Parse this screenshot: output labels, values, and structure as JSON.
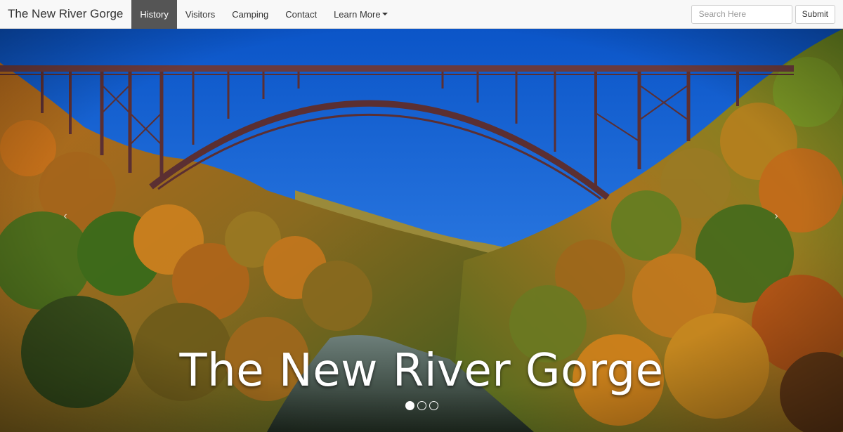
{
  "navbar": {
    "brand": "The New River Gorge",
    "items": [
      {
        "label": "History",
        "active": true
      },
      {
        "label": "Visitors"
      },
      {
        "label": "Camping"
      },
      {
        "label": "Contact"
      },
      {
        "label": "Learn More",
        "dropdown": true
      }
    ],
    "search": {
      "placeholder": "Search Here",
      "value": ""
    },
    "submit_label": "Submit"
  },
  "carousel": {
    "caption": "The New River Gorge",
    "prev_icon": "‹",
    "next_icon": "›",
    "slide_count": 3,
    "active_slide": 1
  },
  "colors": {
    "sky": "#1f74e0",
    "bridge": "#5b2f32",
    "foliage_orange": "#c8741e",
    "foliage_green": "#4f7a22",
    "river": "#2d3a2c"
  }
}
